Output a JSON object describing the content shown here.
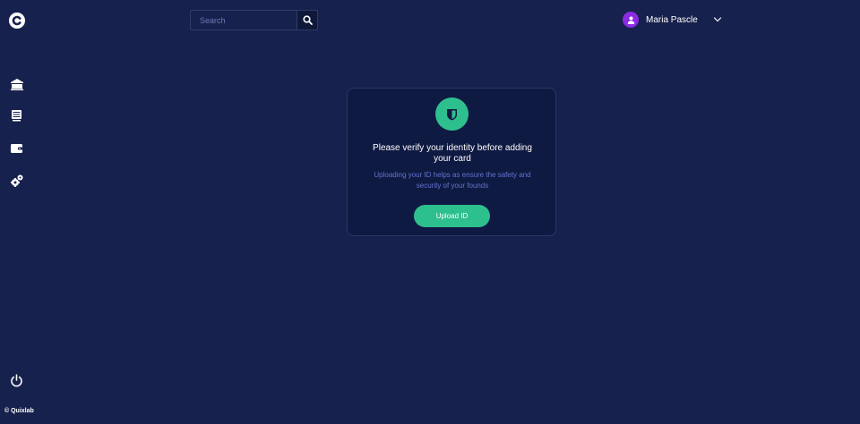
{
  "brand": {
    "logo_icon": "brand-c-logo"
  },
  "sidebar": {
    "items": [
      {
        "icon": "bank-icon"
      },
      {
        "icon": "document-icon"
      },
      {
        "icon": "wallet-icon"
      },
      {
        "icon": "settings-icon"
      }
    ],
    "logout_icon": "power-icon",
    "copyright": "© Quixlab"
  },
  "search": {
    "placeholder": "Search",
    "value": ""
  },
  "user": {
    "name": "Maria Pascle"
  },
  "verify_card": {
    "title": "Please verify your identity before adding your card",
    "description": "Uploading your ID helps as ensure the safety and security of your founds",
    "button_label": "Upload ID"
  },
  "colors": {
    "background": "#17214d",
    "card": "#0f1a42",
    "accent": "#2ebf8f",
    "avatar": "#8b2be2",
    "muted_text": "#6473d0"
  }
}
